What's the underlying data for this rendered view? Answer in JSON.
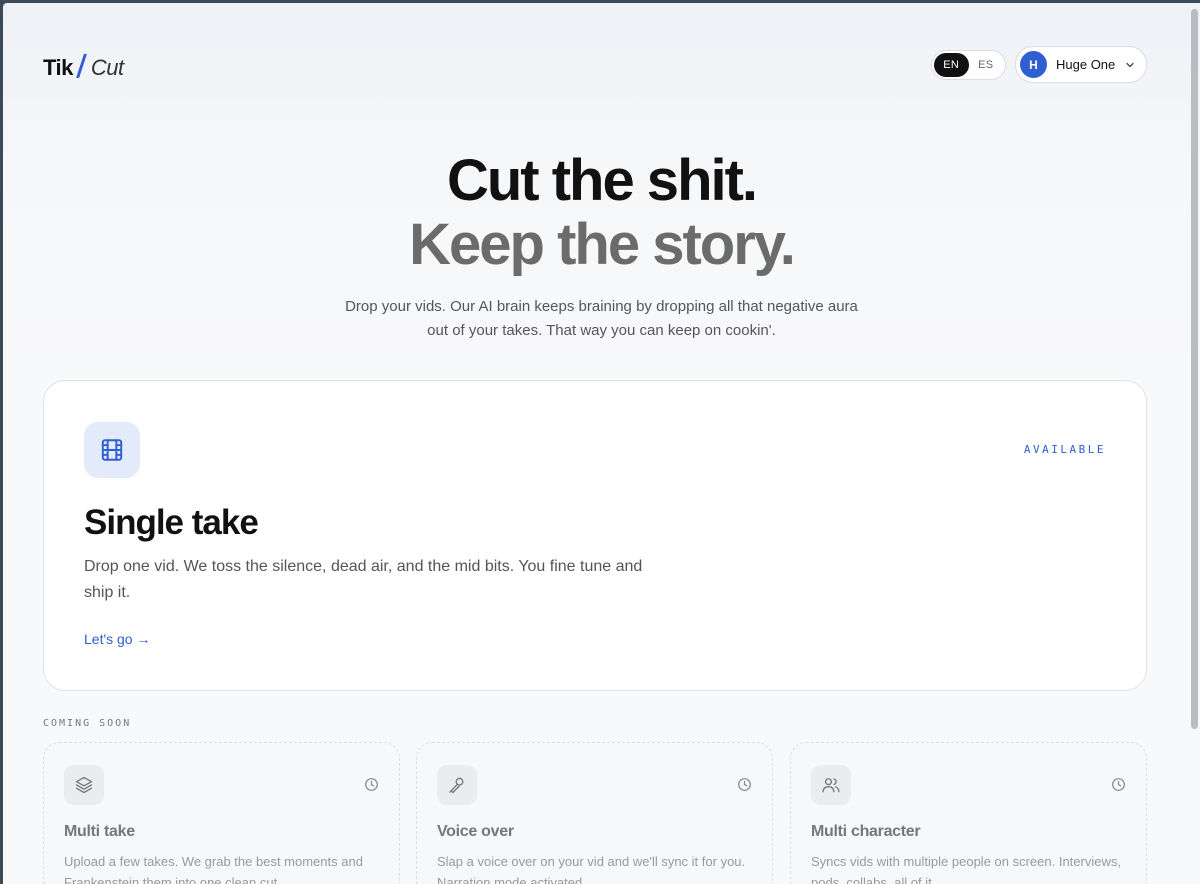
{
  "header": {
    "logo": {
      "part1": "Tik",
      "part2": "Cut"
    },
    "languages": [
      {
        "label": "EN",
        "active": true
      },
      {
        "label": "ES",
        "active": false
      }
    ],
    "user": {
      "initial": "H",
      "name": "Huge One"
    }
  },
  "hero": {
    "line1": "Cut the shit.",
    "line2": "Keep the story.",
    "subtitle": "Drop your vids. Our AI brain keeps braining by dropping all that negative aura out of your takes. That way you can keep on cookin'."
  },
  "main_card": {
    "icon": "film-icon",
    "badge": "AVAILABLE",
    "title": "Single take",
    "description": "Drop one vid. We toss the silence, dead air, and the mid bits. You fine tune and ship it.",
    "link": "Let's go →"
  },
  "coming_soon": {
    "label": "COMING SOON",
    "cards": [
      {
        "icon": "layers-icon",
        "title": "Multi take",
        "description": "Upload a few takes. We grab the best moments and Frankenstein them into one clean cut."
      },
      {
        "icon": "microphone-icon",
        "title": "Voice over",
        "description": "Slap a voice over on your vid and we'll sync it for you. Narration mode activated."
      },
      {
        "icon": "users-icon",
        "title": "Multi character",
        "description": "Syncs vids with multiple people on screen. Interviews, pods, collabs, all of it."
      }
    ]
  },
  "colors": {
    "accent": "#2f5fd0",
    "text": "#111111",
    "muted": "#6b6b6b"
  }
}
